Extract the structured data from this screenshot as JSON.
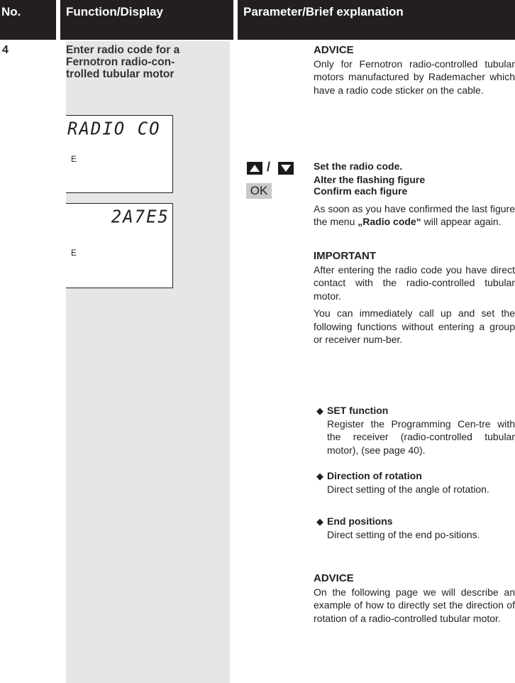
{
  "header": {
    "no": "No.",
    "function": "Function/Display",
    "parameter": "Parameter/Brief explanation"
  },
  "step": {
    "number": "4",
    "title_line1": "Enter radio code for a",
    "title_line2": "Fernotron radio-con-",
    "title_line3": "trolled  tubular motor"
  },
  "display1": {
    "main": "RADIO CO",
    "sub": "E"
  },
  "display2": {
    "main": "2A7E5",
    "sub": "E"
  },
  "keys": {
    "slash": "/",
    "ok": "OK"
  },
  "advice1": {
    "heading": "ADVICE",
    "text": "Only for Fernotron radio-controlled tubular motors manufactured by Rademacher which have a radio code sticker on the cable."
  },
  "set_code": {
    "line1": "Set the radio code.",
    "line2": "Alter the flashing figure"
  },
  "confirm": {
    "heading": "Confirm each figure",
    "text_before": "As soon as you have confirmed the last figure the menu ",
    "menu_name": "„Radio code“",
    "text_after": " will appear again."
  },
  "important": {
    "heading": "IMPORTANT",
    "text1": "After entering the radio code you have direct contact with the radio-controlled tubular motor.",
    "text2": "You can immediately call up and set the following functions without entering a group or receiver num-ber."
  },
  "bullets": [
    {
      "symbol": "◆",
      "title": "SET function",
      "text": "Register the Programming Cen-tre with the receiver (radio-controlled tubular motor), (see page 40)."
    },
    {
      "symbol": "◆",
      "title": "Direction of rotation",
      "text": "Direct setting of the angle of rotation."
    },
    {
      "symbol": "◆",
      "title": "End positions",
      "text": "Direct setting of the  end po-sitions."
    }
  ],
  "advice2": {
    "heading": "ADVICE",
    "text": "On the following page we will describe an example of how to directly set the direction of rotation of a radio-controlled tubular motor."
  }
}
